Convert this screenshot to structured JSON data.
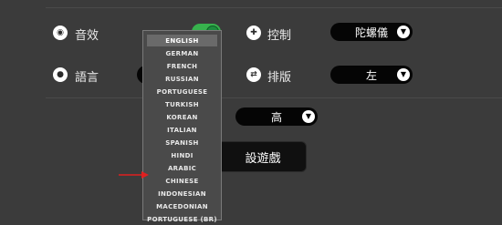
{
  "settings": {
    "sound": {
      "icon": "speaker-icon",
      "label": "音效"
    },
    "controls": {
      "icon": "gamepad-icon",
      "label": "控制",
      "value": "陀螺儀"
    },
    "language": {
      "icon": "speech-bubble-icon",
      "label": "語言"
    },
    "layout": {
      "icon": "swap-arrows-icon",
      "label": "排版",
      "value": "左"
    },
    "quality": {
      "value": "高"
    },
    "reset_button_label": "設遊戲"
  },
  "language_dropdown": {
    "selected": "ENGLISH",
    "options": [
      "ENGLISH",
      "GERMAN",
      "FRENCH",
      "RUSSIAN",
      "PORTUGUESE",
      "TURKISH",
      "KOREAN",
      "ITALIAN",
      "SPANISH",
      "HINDI",
      "ARABIC",
      "CHINESE",
      "INDONESIAN",
      "MACEDONIAN",
      "PORTUGUESE (BR)"
    ]
  },
  "annotation": {
    "arrow_color": "#e02020",
    "points_to": "CHINESE"
  },
  "colors": {
    "background": "#3b3b3b",
    "toggle_on": "#37b24d",
    "select_bg": "#050505"
  }
}
